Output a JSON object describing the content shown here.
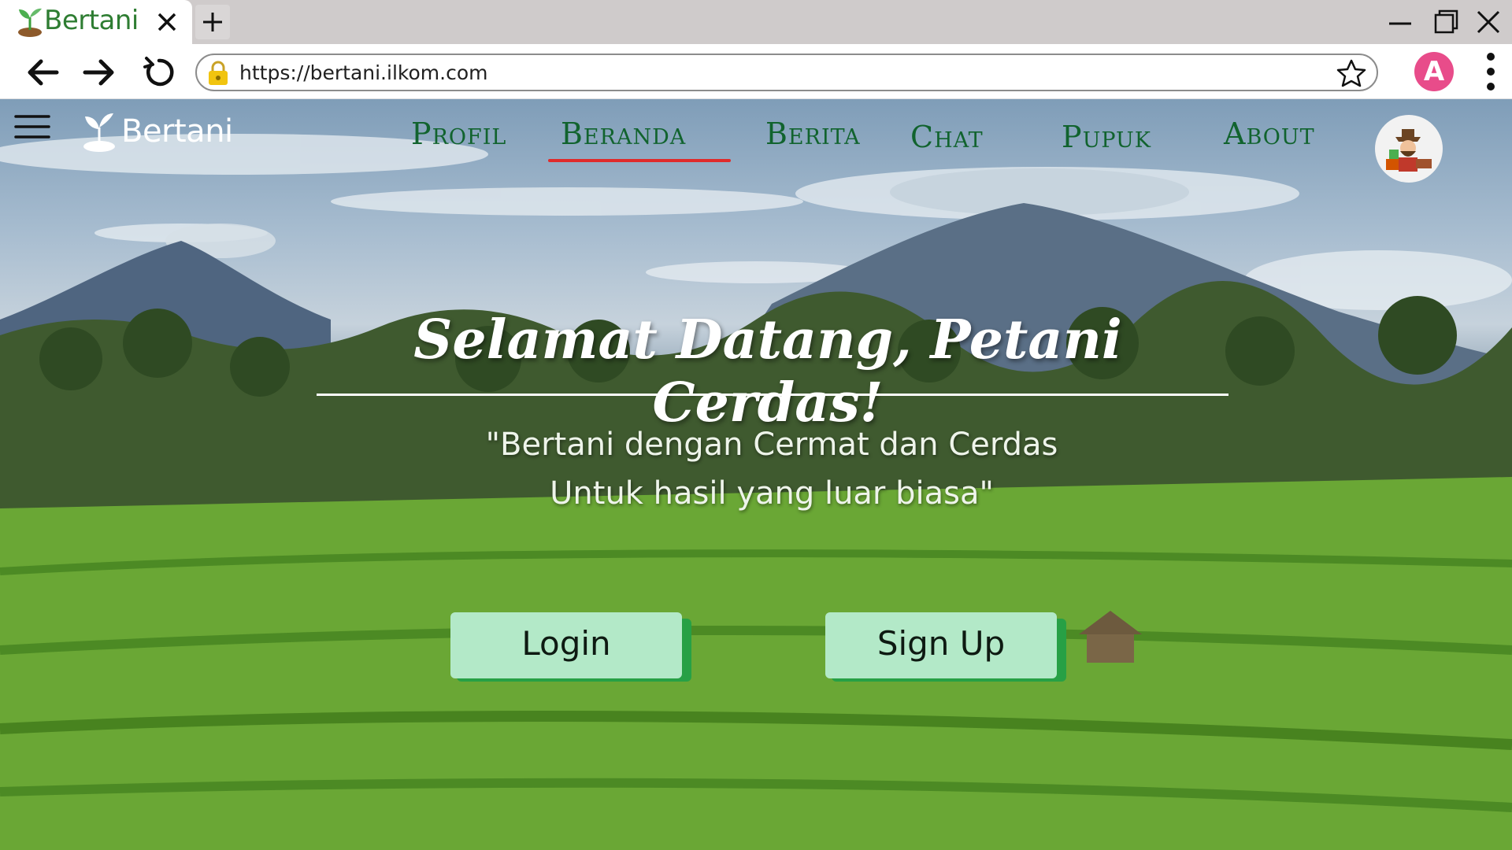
{
  "browser": {
    "tab_title": "Bertani",
    "url": "https://bertani.ilkom.com",
    "profile_initial": "A"
  },
  "site": {
    "logo_text": "Bertani",
    "nav": [
      {
        "label": "Profil",
        "active": false
      },
      {
        "label": "Beranda",
        "active": true
      },
      {
        "label": "Berita",
        "active": false
      },
      {
        "label": "Chat",
        "active": false
      },
      {
        "label": "Pupuk",
        "active": false
      },
      {
        "label": "About",
        "active": false
      }
    ],
    "active_color": "#e02b2b",
    "nav_color": "#11632e"
  },
  "hero": {
    "title": "Selamat Datang, Petani Cerdas!",
    "tagline_line1": "\"Bertani dengan Cermat dan Cerdas",
    "tagline_line2": "Untuk hasil yang luar biasa\""
  },
  "buttons": {
    "login": "Login",
    "signup": "Sign Up",
    "face_color": "#b3e9c8",
    "shadow_color": "#27a045"
  }
}
